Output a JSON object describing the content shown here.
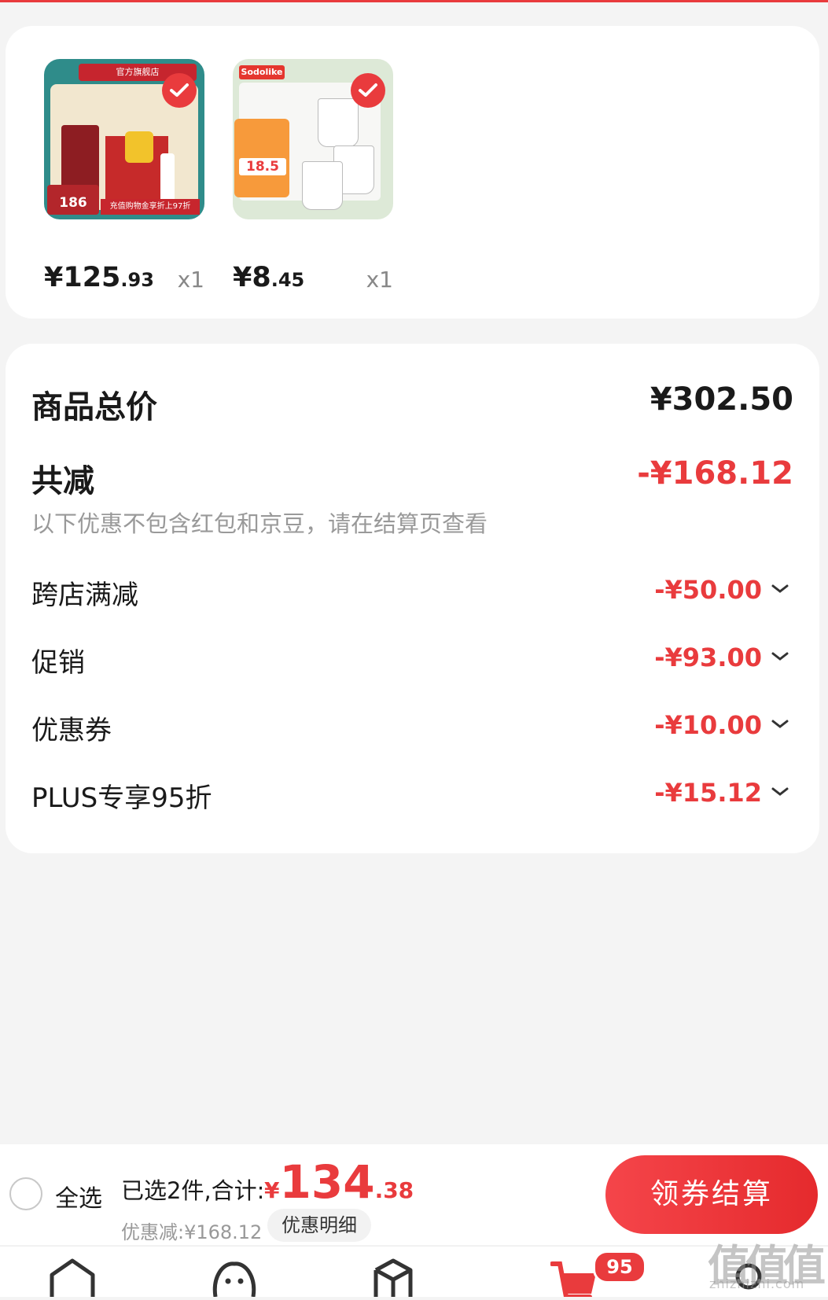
{
  "colors": {
    "accent": "#e93b3d",
    "background": "#f4f4f4",
    "card": "#ffffff"
  },
  "products": [
    {
      "id": "p1",
      "price_int": "¥125",
      "price_dec": ".93",
      "qty": "x1",
      "selected": true,
      "thumb_banner": "官方旗舰店",
      "thumb_tag": "186",
      "thumb_strip": "充值购物金享折上97折"
    },
    {
      "id": "p2",
      "price_int": "¥8",
      "price_dec": ".45",
      "qty": "x1",
      "selected": true,
      "thumb_brand": "Sodolike",
      "thumb_promo_price": "18.5"
    }
  ],
  "summary": {
    "total_label": "商品总价",
    "total_value": "¥302.50",
    "reduce_label": "共减",
    "reduce_value": "-¥168.12",
    "note": "以下优惠不包含红包和京豆，请在结算页查看",
    "items": [
      {
        "label": "跨店满减",
        "value": "-¥50.00"
      },
      {
        "label": "促销",
        "value": "-¥93.00"
      },
      {
        "label": "优惠券",
        "value": "-¥10.00"
      },
      {
        "label": "PLUS专享95折",
        "value": "-¥15.12"
      }
    ]
  },
  "bottom_bar": {
    "select_all": "全选",
    "selected_text": "已选2件,合计:",
    "total_currency": "¥",
    "total_int": "134",
    "total_dec": ".38",
    "discount_text": "优惠减:¥168.12",
    "detail_button": "优惠明细",
    "checkout_button": "领券结算"
  },
  "tab_bar": {
    "cart_badge": "95",
    "icons": [
      "home-icon",
      "discover-icon",
      "category-icon",
      "cart-icon",
      "profile-icon"
    ]
  },
  "watermark": {
    "main": "值值值",
    "sub": "zhizhizhi.com"
  }
}
